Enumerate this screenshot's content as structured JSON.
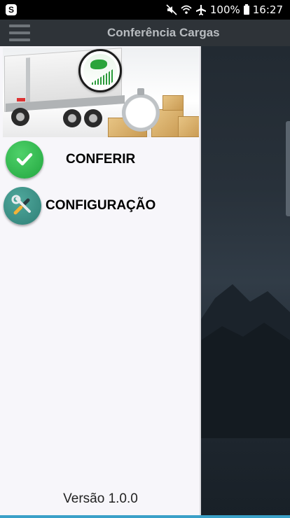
{
  "status_bar": {
    "battery_percent": "100%",
    "time": "16:27",
    "app_icon": "s-notification-icon",
    "icons": [
      "mute-icon",
      "wifi-icon",
      "airplane-icon",
      "battery-icon"
    ]
  },
  "app_bar": {
    "title": "Conferência Cargas",
    "menu_icon": "hamburger-menu-icon"
  },
  "drawer": {
    "hero_image": "truck-cargo-stopwatch-banner",
    "items": [
      {
        "label": "CONFERIR",
        "icon": "check-circle-icon"
      },
      {
        "label": "CONFIGURAÇÃO",
        "icon": "tools-icon"
      }
    ],
    "version": "Versão 1.0.0"
  },
  "colors": {
    "app_bar": "#2e3338",
    "drawer_bg": "#f7f6fa",
    "check_green": "#22a63f",
    "tools_teal": "#2f7f76",
    "accent_line": "#3aa0c8"
  }
}
